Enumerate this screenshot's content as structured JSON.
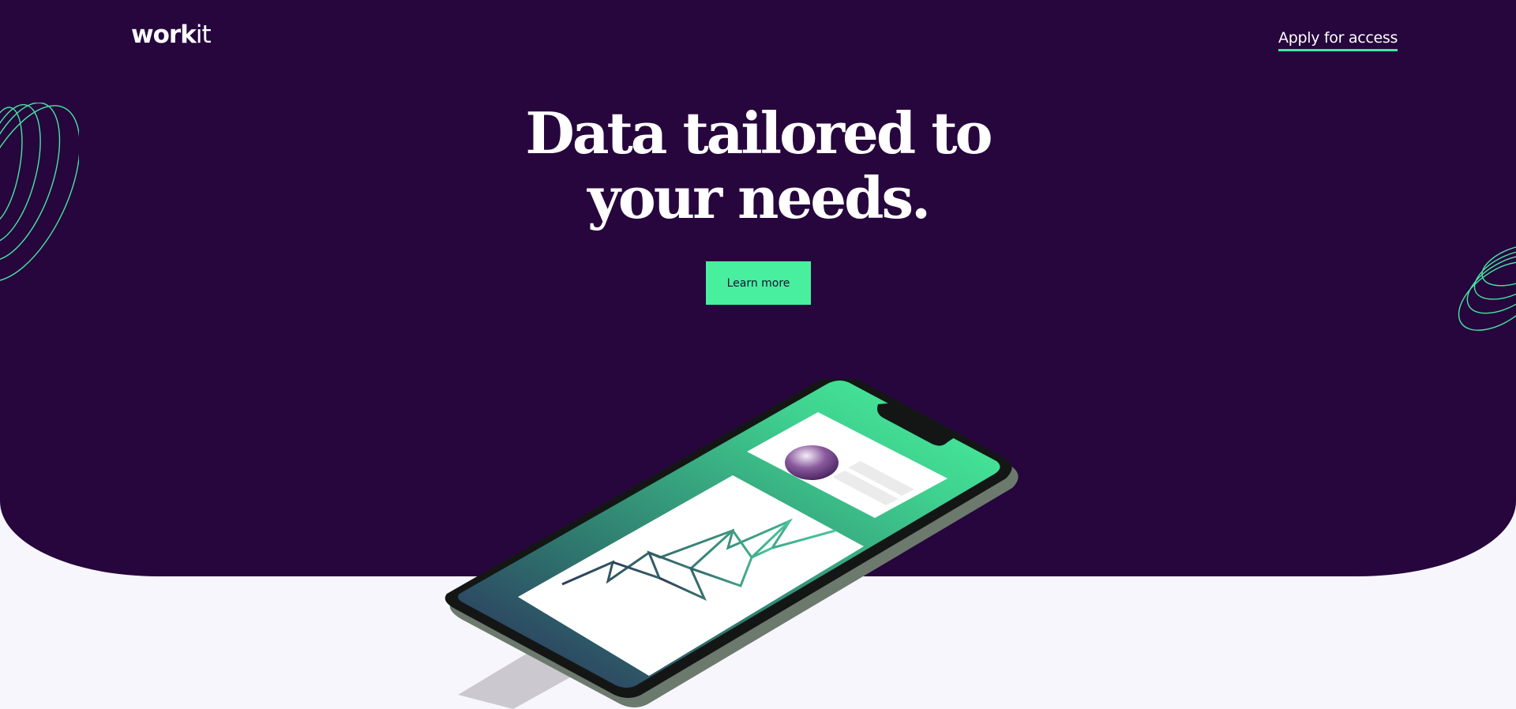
{
  "header": {
    "logo_bold": "work",
    "logo_light": "it",
    "nav_link": "Apply for access"
  },
  "hero": {
    "headline_line1": "Data tailored to",
    "headline_line2": "your needs.",
    "cta_label": "Learn more"
  },
  "colors": {
    "hero_bg": "#26063d",
    "accent": "#48ef9f",
    "page_bg": "#f8f6fd"
  }
}
